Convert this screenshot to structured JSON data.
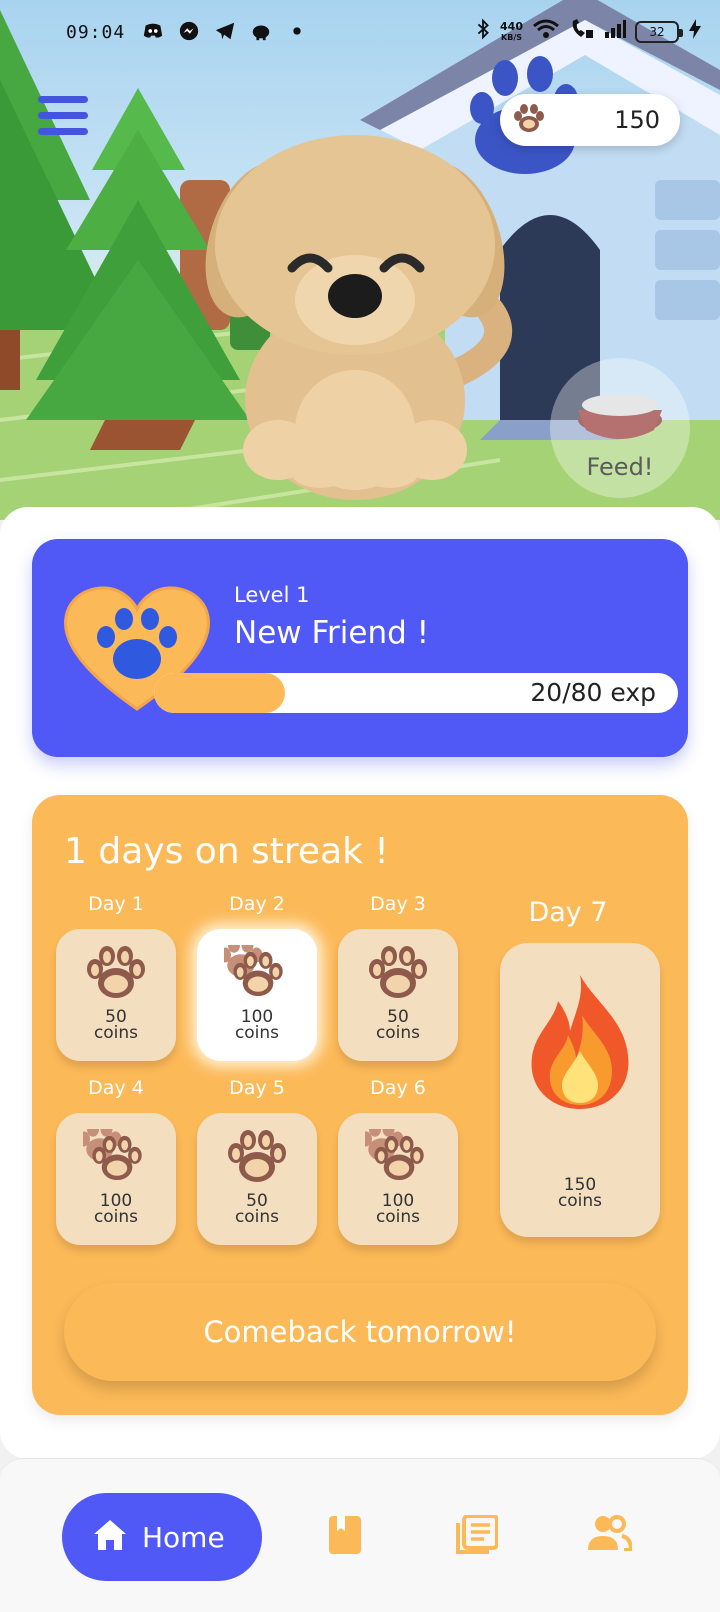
{
  "status_bar": {
    "time": "09:04",
    "speed_value": "440",
    "speed_unit": "KB/S",
    "battery": "32"
  },
  "hero": {
    "coins": "150",
    "feed_label": "Feed!"
  },
  "level": {
    "level_label": "Level 1",
    "title": "New Friend !",
    "exp_text": "20/80 exp",
    "progress": 0.25
  },
  "streak": {
    "title": "1 days on streak !",
    "days": [
      {
        "label": "Day 1",
        "amount": "50",
        "unit": "coins"
      },
      {
        "label": "Day 2",
        "amount": "100",
        "unit": "coins"
      },
      {
        "label": "Day 3",
        "amount": "50",
        "unit": "coins"
      },
      {
        "label": "Day 4",
        "amount": "100",
        "unit": "coins"
      },
      {
        "label": "Day 5",
        "amount": "50",
        "unit": "coins"
      },
      {
        "label": "Day 6",
        "amount": "100",
        "unit": "coins"
      }
    ],
    "day7": {
      "label": "Day 7",
      "amount": "150",
      "unit": "coins"
    },
    "button_label": "Comeback tomorrow!"
  },
  "nav": {
    "home_label": "Home",
    "icons": [
      "home-icon",
      "book-icon",
      "news-icon",
      "people-icon"
    ]
  },
  "colors": {
    "primary": "#5058f6",
    "accent": "#fcb958",
    "tile": "#f3dec0",
    "paw": "#8d5a4b"
  }
}
